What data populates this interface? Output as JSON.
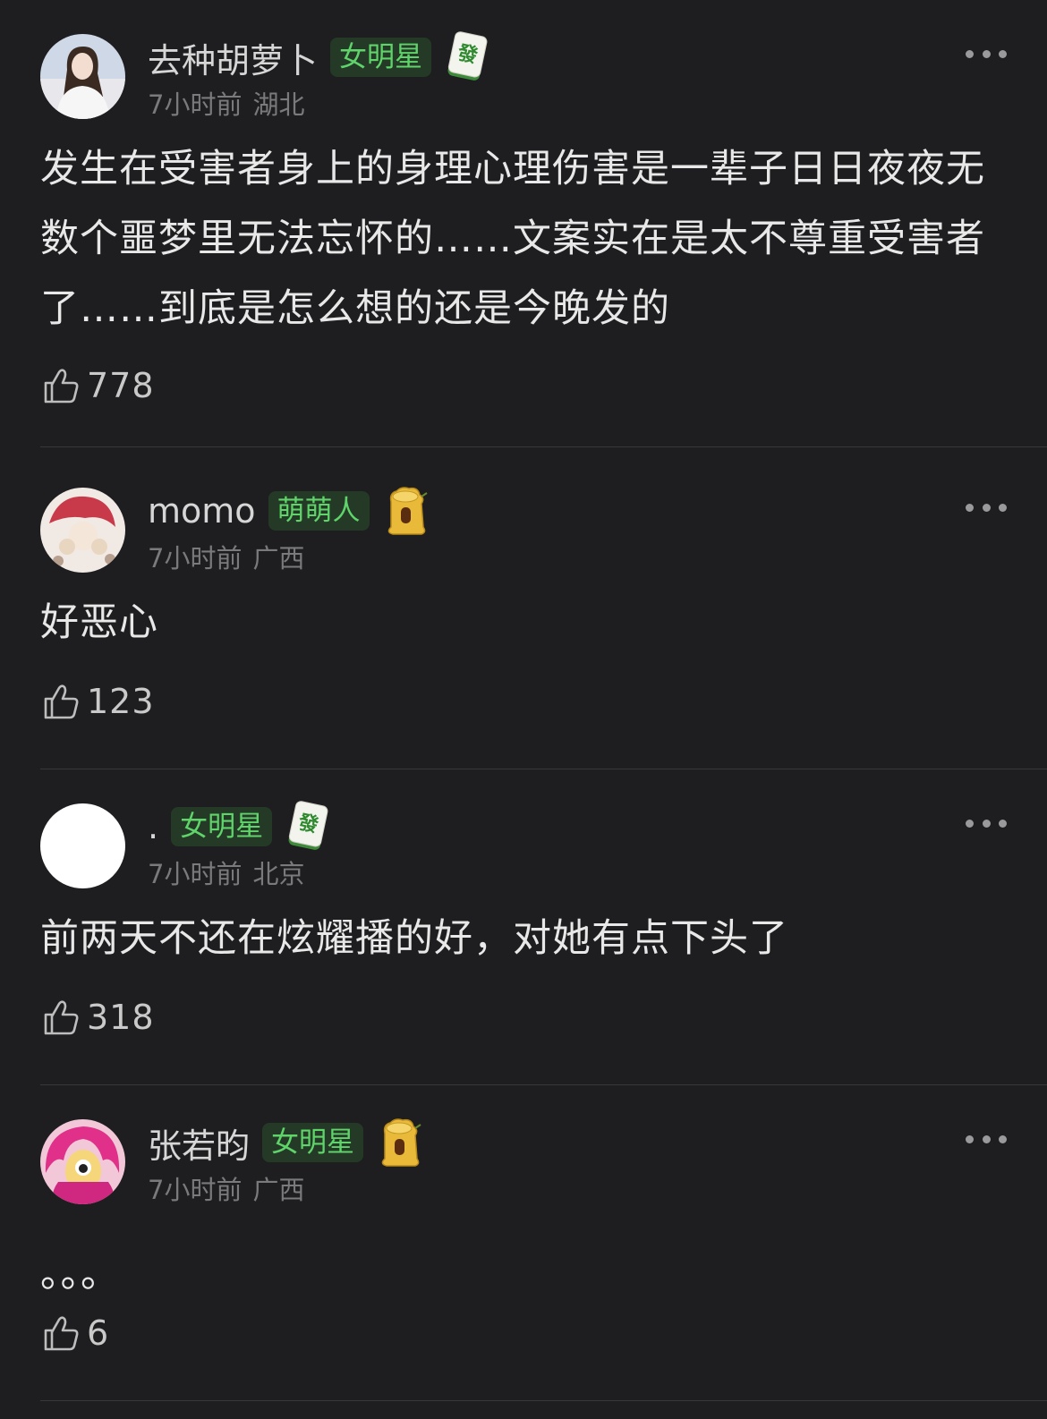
{
  "comments": [
    {
      "username": "去种胡萝卜",
      "tag": "女明星",
      "badge_icon": "mahjong-fa-icon",
      "time": "7小时前",
      "location": "湖北",
      "text": "发生在受害者身上的身理心理伤害是一辈子日日夜夜无数个噩梦里无法忘怀的……文案实在是太不尊重受害者了……到底是怎么想的还是今晚发的",
      "likes": "778"
    },
    {
      "username": "momo",
      "tag": "萌萌人",
      "badge_icon": "tree-stump-icon",
      "time": "7小时前",
      "location": "广西",
      "text": "好恶心",
      "likes": "123"
    },
    {
      "username": ".",
      "tag": "女明星",
      "badge_icon": "mahjong-fa-icon",
      "time": "7小时前",
      "location": "北京",
      "text": "前两天不还在炫耀播的好，对她有点下头了",
      "likes": "318"
    },
    {
      "username": "张若昀",
      "tag": "女明星",
      "badge_icon": "tree-stump-icon",
      "time": "7小时前",
      "location": "广西",
      "text": "。。。",
      "likes": "6"
    }
  ],
  "colors": {
    "background": "#1e1e20",
    "tag_text": "#5fd46a",
    "tag_bg": "#243a26"
  }
}
